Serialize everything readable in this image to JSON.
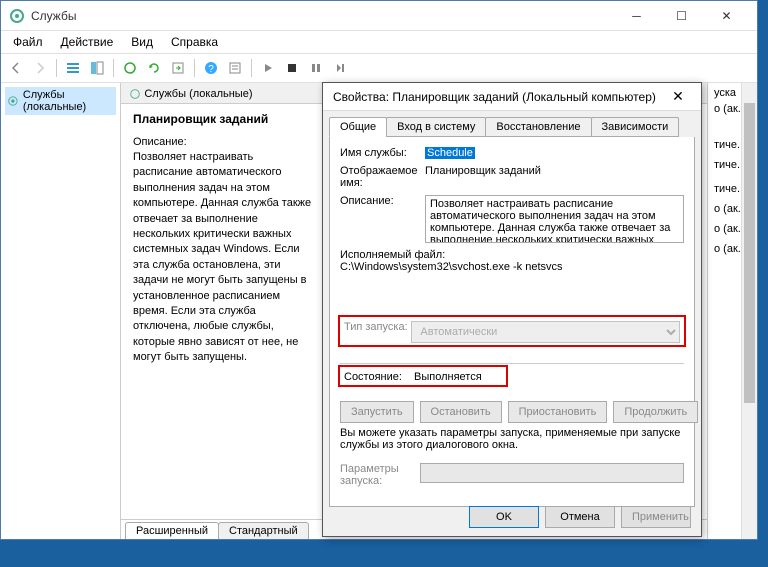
{
  "main": {
    "title": "Службы",
    "menu": {
      "file": "Файл",
      "action": "Действие",
      "view": "Вид",
      "help": "Справка"
    },
    "tree": {
      "root": "Службы (локальные)"
    },
    "panelHeader": "Службы (локальные)",
    "serviceName": "Планировщик заданий",
    "descLabel": "Описание:",
    "descText": "Позволяет настраивать расписание автоматического выполнения задач на этом компьютере. Данная служба также отвечает за выполнение нескольких критически важных системных задач Windows. Если эта служба остановлена, эти задачи не могут быть запущены в установленное расписанием время. Если эта служба отключена, любые службы, которые явно зависят от нее, не могут быть запущены.",
    "tabs": {
      "ext": "Расширенный",
      "std": "Стандартный"
    },
    "rightItems": [
      "уска",
      "о (ак...",
      "",
      "",
      "",
      "",
      "",
      "тиче...",
      "",
      "тиче...",
      "",
      "",
      "тиче...",
      "",
      "о (ак...",
      "",
      "о (ак...",
      "",
      "о (ак..."
    ]
  },
  "dialog": {
    "title": "Свойства: Планировщик заданий (Локальный компьютер)",
    "tabs": {
      "general": "Общие",
      "logon": "Вход в систему",
      "recovery": "Восстановление",
      "deps": "Зависимости"
    },
    "labels": {
      "svcName": "Имя службы:",
      "dispName": "Отображаемое имя:",
      "desc": "Описание:",
      "exe": "Исполняемый файл:",
      "startup": "Тип запуска:",
      "state": "Состояние:",
      "paramsNote": "Вы можете указать параметры запуска, применяемые при запуске службы из этого диалогового окна.",
      "params": "Параметры запуска:"
    },
    "values": {
      "svcName": "Schedule",
      "dispName": "Планировщик заданий",
      "desc": "Позволяет настраивать расписание автоматического выполнения задач на этом компьютере. Данная служба также отвечает за выполнение нескольких критически важных",
      "exePath": "C:\\Windows\\system32\\svchost.exe -k netsvcs",
      "startup": "Автоматически",
      "state": "Выполняется"
    },
    "buttons": {
      "start": "Запустить",
      "stop": "Остановить",
      "pause": "Приостановить",
      "resume": "Продолжить",
      "ok": "OK",
      "cancel": "Отмена",
      "apply": "Применить"
    }
  }
}
